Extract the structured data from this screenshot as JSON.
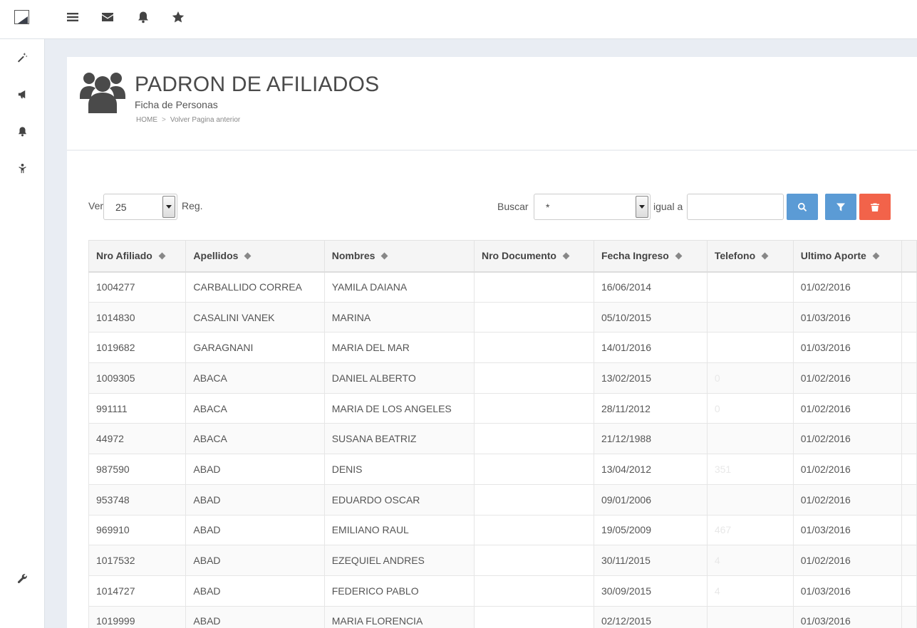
{
  "topbar": {
    "icons": [
      "menu-icon",
      "envelope-icon",
      "bell-icon",
      "star-icon"
    ]
  },
  "sidebar": {
    "icons": [
      "magic-wand-icon",
      "megaphone-icon",
      "bell-icon",
      "person-icon",
      "wrench-icon"
    ]
  },
  "header": {
    "title": "PADRON DE AFILIADOS",
    "subtitle": "Ficha de Personas",
    "breadcrumb": [
      "HOME",
      "Volver Pagina anterior"
    ]
  },
  "controls": {
    "show_label": "Ver",
    "page_size": "25",
    "records_label": "Reg.",
    "search_label": "Buscar",
    "search_field": "*",
    "equals_label": "igual a",
    "search_value": "",
    "colors": {
      "search": "#5b9bd5",
      "filter": "#5b9bd5",
      "delete": "#f2634a"
    }
  },
  "table": {
    "columns": [
      "Nro Afiliado",
      "Apellidos",
      "Nombres",
      "Nro Documento",
      "Fecha Ingreso",
      "Telefono",
      "Ultimo Aporte"
    ],
    "rows": [
      [
        "1004277",
        "CARBALLIDO CORREA",
        "YAMILA DAIANA",
        "",
        "16/06/2014",
        "",
        "01/02/2016"
      ],
      [
        "1014830",
        "CASALINI VANEK",
        "MARINA",
        "",
        "05/10/2015",
        "",
        "01/03/2016"
      ],
      [
        "1019682",
        "GARAGNANI",
        "MARIA DEL MAR",
        "",
        "14/01/2016",
        "",
        "01/03/2016"
      ],
      [
        "1009305",
        "ABACA",
        "DANIEL ALBERTO",
        "",
        "13/02/2015",
        "0",
        "01/02/2016"
      ],
      [
        "991111",
        "ABACA",
        "MARIA DE LOS ANGELES",
        "",
        "28/11/2012",
        "0",
        "01/02/2016"
      ],
      [
        "44972",
        "ABACA",
        "SUSANA BEATRIZ",
        "",
        "21/12/1988",
        "",
        "01/02/2016"
      ],
      [
        "987590",
        "ABAD",
        "DENIS",
        "",
        "13/04/2012",
        "351",
        "01/02/2016"
      ],
      [
        "953748",
        "ABAD",
        "EDUARDO OSCAR",
        "",
        "09/01/2006",
        "",
        "01/02/2016"
      ],
      [
        "969910",
        "ABAD",
        "EMILIANO RAUL",
        "",
        "19/05/2009",
        "467",
        "01/03/2016"
      ],
      [
        "1017532",
        "ABAD",
        "EZEQUIEL ANDRES",
        "",
        "30/11/2015",
        "4",
        "01/02/2016"
      ],
      [
        "1014727",
        "ABAD",
        "FEDERICO PABLO",
        "",
        "30/09/2015",
        "4",
        "01/03/2016"
      ],
      [
        "1019999",
        "ABAD",
        "MARIA FLORENCIA",
        "",
        "02/12/2015",
        "",
        "01/03/2016"
      ]
    ]
  }
}
